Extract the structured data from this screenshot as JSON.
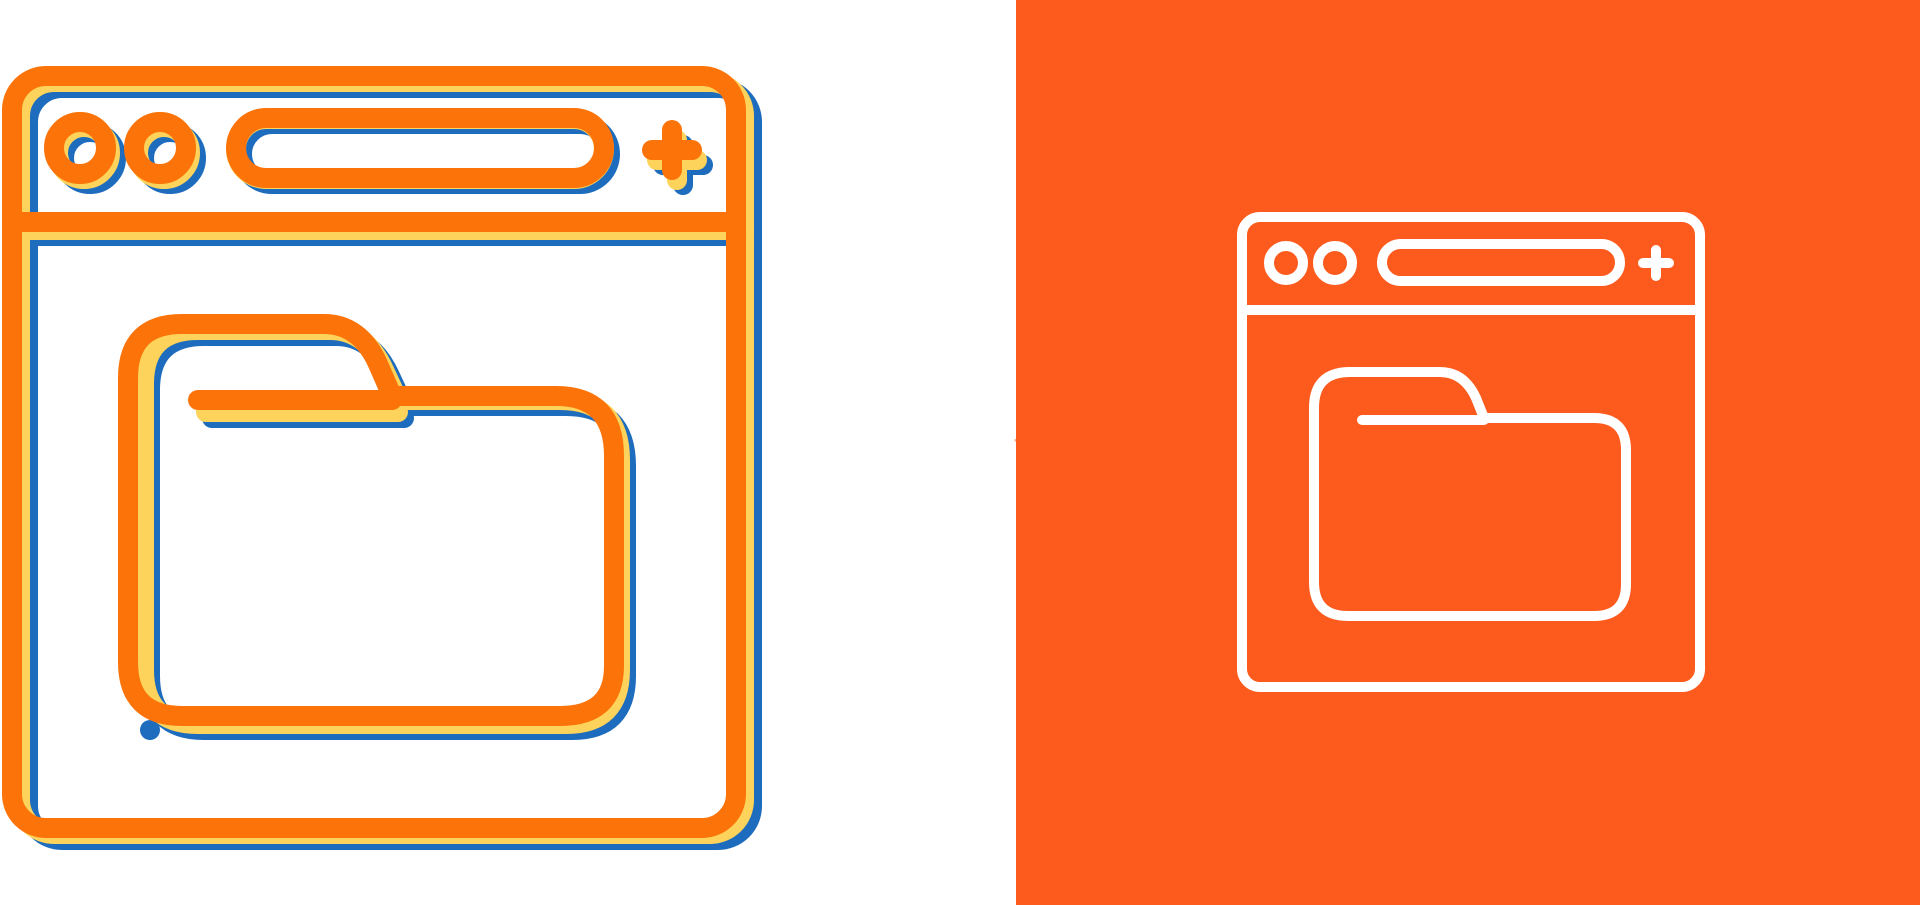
{
  "colors": {
    "background_left": "#ffffff",
    "background_right": "#fd5a1e",
    "icon_primary": "#fb7309",
    "icon_shadow_yellow": "#fdd35b",
    "icon_shadow_blue": "#1d6cbd",
    "icon_outline_white": "#ffffff"
  },
  "icons": {
    "left": "browser-folder-icon-multicolor",
    "right": "browser-folder-icon-outline"
  }
}
